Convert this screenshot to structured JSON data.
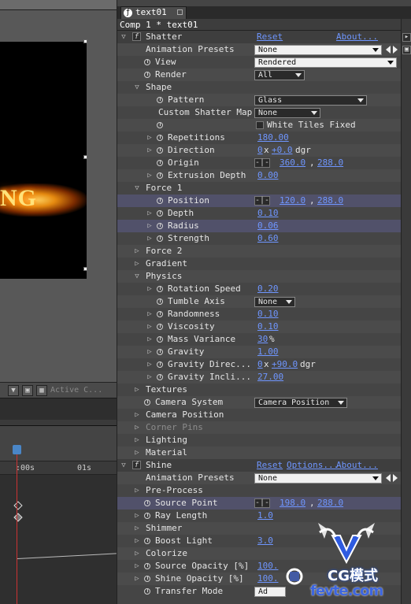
{
  "tab": {
    "title": "text01"
  },
  "breadcrumb": "Comp 1 * text01",
  "comp": {
    "glow_text": "NG"
  },
  "viewer_bar": {
    "camera": "Active C..."
  },
  "timeline": {
    "t0": ":00s",
    "t1": "01s"
  },
  "effects": {
    "shatter": {
      "name": "Shatter",
      "reset": "Reset",
      "about": "About...",
      "animation_presets_label": "Animation Presets",
      "animation_presets_value": "None",
      "view_label": "View",
      "view_value": "Rendered",
      "render_label": "Render",
      "render_value": "All",
      "shape_label": "Shape",
      "pattern_label": "Pattern",
      "pattern_value": "Glass",
      "custom_map_label": "Custom Shatter Map",
      "custom_map_value": "None",
      "white_tiles_label": "White Tiles Fixed",
      "repetitions_label": "Repetitions",
      "repetitions_value": "180.00",
      "direction_label": "Direction",
      "direction_turns": "0",
      "direction_deg": "+0.0",
      "direction_unit": "dgr",
      "origin_label": "Origin",
      "origin_x": "360.0",
      "origin_y": "288.0",
      "extrusion_label": "Extrusion Depth",
      "extrusion_value": "0.00",
      "force1_label": "Force 1",
      "position_label": "Position",
      "position_x": "120.0",
      "position_y": "288.0",
      "depth_label": "Depth",
      "depth_value": "0.10",
      "radius_label": "Radius",
      "radius_value": "0.06",
      "strength_label": "Strength",
      "strength_value": "0.60",
      "force2_label": "Force 2",
      "gradient_label": "Gradient",
      "physics_label": "Physics",
      "rotation_speed_label": "Rotation Speed",
      "rotation_speed_value": "0.20",
      "tumble_axis_label": "Tumble Axis",
      "tumble_axis_value": "None",
      "randomness_label": "Randomness",
      "randomness_value": "0.10",
      "viscosity_label": "Viscosity",
      "viscosity_value": "0.10",
      "mass_variance_label": "Mass Variance",
      "mass_variance_value": "30",
      "mass_variance_unit": "%",
      "gravity_label": "Gravity",
      "gravity_value": "1.00",
      "gravity_dir_label": "Gravity Direc...",
      "gravity_dir_turns": "0",
      "gravity_dir_deg": "+90.0",
      "gravity_dir_unit": "dgr",
      "gravity_incl_label": "Gravity Incli...",
      "gravity_incl_value": "27.00",
      "textures_label": "Textures",
      "camera_system_label": "Camera System",
      "camera_system_value": "Camera Position",
      "camera_position_label": "Camera Position",
      "corner_pins_label": "Corner Pins",
      "lighting_label": "Lighting",
      "material_label": "Material"
    },
    "shine": {
      "name": "Shine",
      "reset": "Reset",
      "options": "Options...",
      "about": "About...",
      "animation_presets_label": "Animation Presets",
      "animation_presets_value": "None",
      "preprocess_label": "Pre-Process",
      "source_point_label": "Source Point",
      "source_point_x": "198.0",
      "source_point_y": "288.0",
      "ray_length_label": "Ray Length",
      "ray_length_value": "1.0",
      "shimmer_label": "Shimmer",
      "boost_light_label": "Boost Light",
      "boost_light_value": "3.0",
      "colorize_label": "Colorize",
      "source_opacity_label": "Source Opacity [%]",
      "source_opacity_value": "100.",
      "shine_opacity_label": "Shine Opacity [%]",
      "shine_opacity_value": "100.",
      "transfer_mode_label": "Transfer Mode",
      "transfer_mode_value": "Ad"
    }
  },
  "watermark": {
    "text": "CG模式",
    "url": "fevte.com"
  }
}
